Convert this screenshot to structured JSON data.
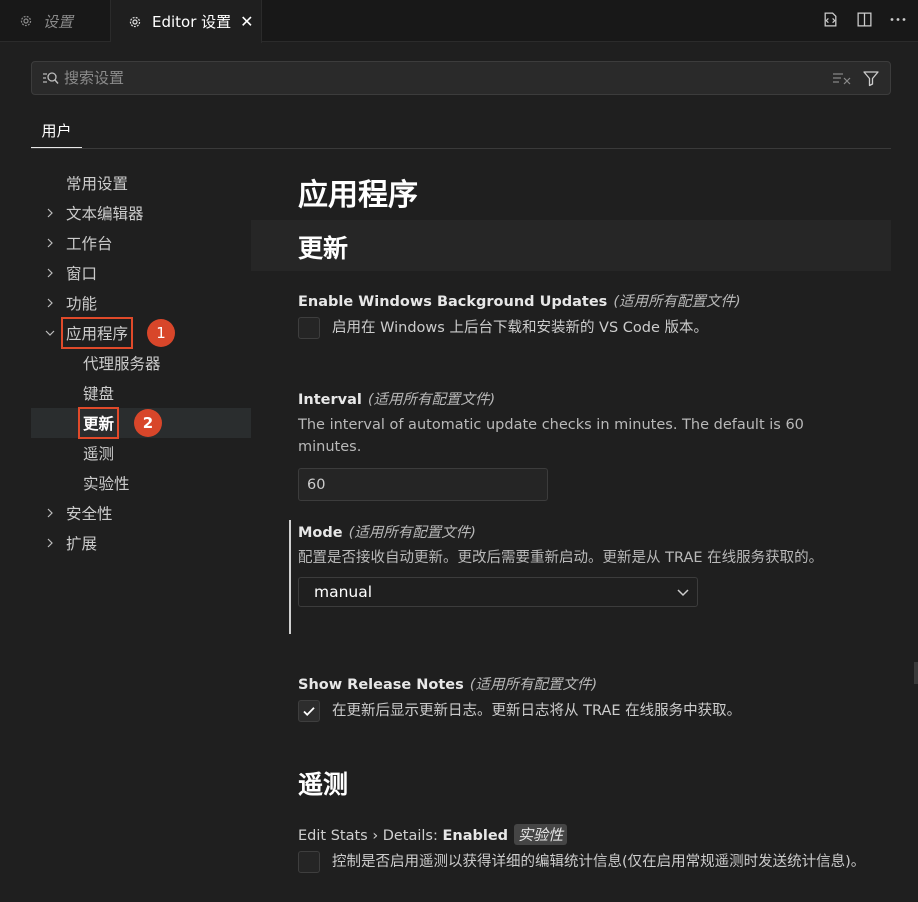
{
  "tabs": {
    "inactive": {
      "label": "设置"
    },
    "active": {
      "label": "Editor 设置",
      "close": "✕"
    }
  },
  "search": {
    "placeholder": "搜索设置"
  },
  "scope_tab": {
    "label": "用户"
  },
  "toc": {
    "items": [
      {
        "label": "常用设置"
      },
      {
        "label": "文本编辑器"
      },
      {
        "label": "工作台"
      },
      {
        "label": "窗口"
      },
      {
        "label": "功能"
      },
      {
        "label": "应用程序"
      },
      {
        "label": "代理服务器"
      },
      {
        "label": "键盘"
      },
      {
        "label": "更新"
      },
      {
        "label": "遥测"
      },
      {
        "label": "实验性"
      },
      {
        "label": "安全性"
      },
      {
        "label": "扩展"
      }
    ],
    "badge1": "1",
    "badge2": "2"
  },
  "content": {
    "heading": "应用程序",
    "section_update": "更新",
    "section_telemetry": "遥测",
    "scope_text": "(适用所有配置文件)",
    "bg_updates": {
      "title": "Enable Windows Background Updates",
      "desc": "启用在 Windows 上后台下载和安装新的 VS Code 版本。",
      "checked": false
    },
    "interval": {
      "title": "Interval",
      "desc": "The interval of automatic update checks in minutes. The default is 60 minutes.",
      "value": "60"
    },
    "mode": {
      "title": "Mode",
      "desc": "配置是否接收自动更新。更改后需要重新启动。更新是从 TRAE 在线服务获取的。",
      "value": "manual"
    },
    "release_notes": {
      "title": "Show Release Notes",
      "desc": "在更新后显示更新日志。更新日志将从 TRAE 在线服务中获取。",
      "checked": true
    },
    "edit_stats": {
      "title_prefix": "Edit Stats › Details: ",
      "title_main": "Enabled",
      "badge": "实验性",
      "desc": "控制是否启用遥测以获得详细的编辑统计信息(仅在启用常规遥测时发送统计信息)。",
      "checked": false
    }
  },
  "colors": {
    "accent_annotation": "#d8462a",
    "background": "#1f1f1f"
  }
}
